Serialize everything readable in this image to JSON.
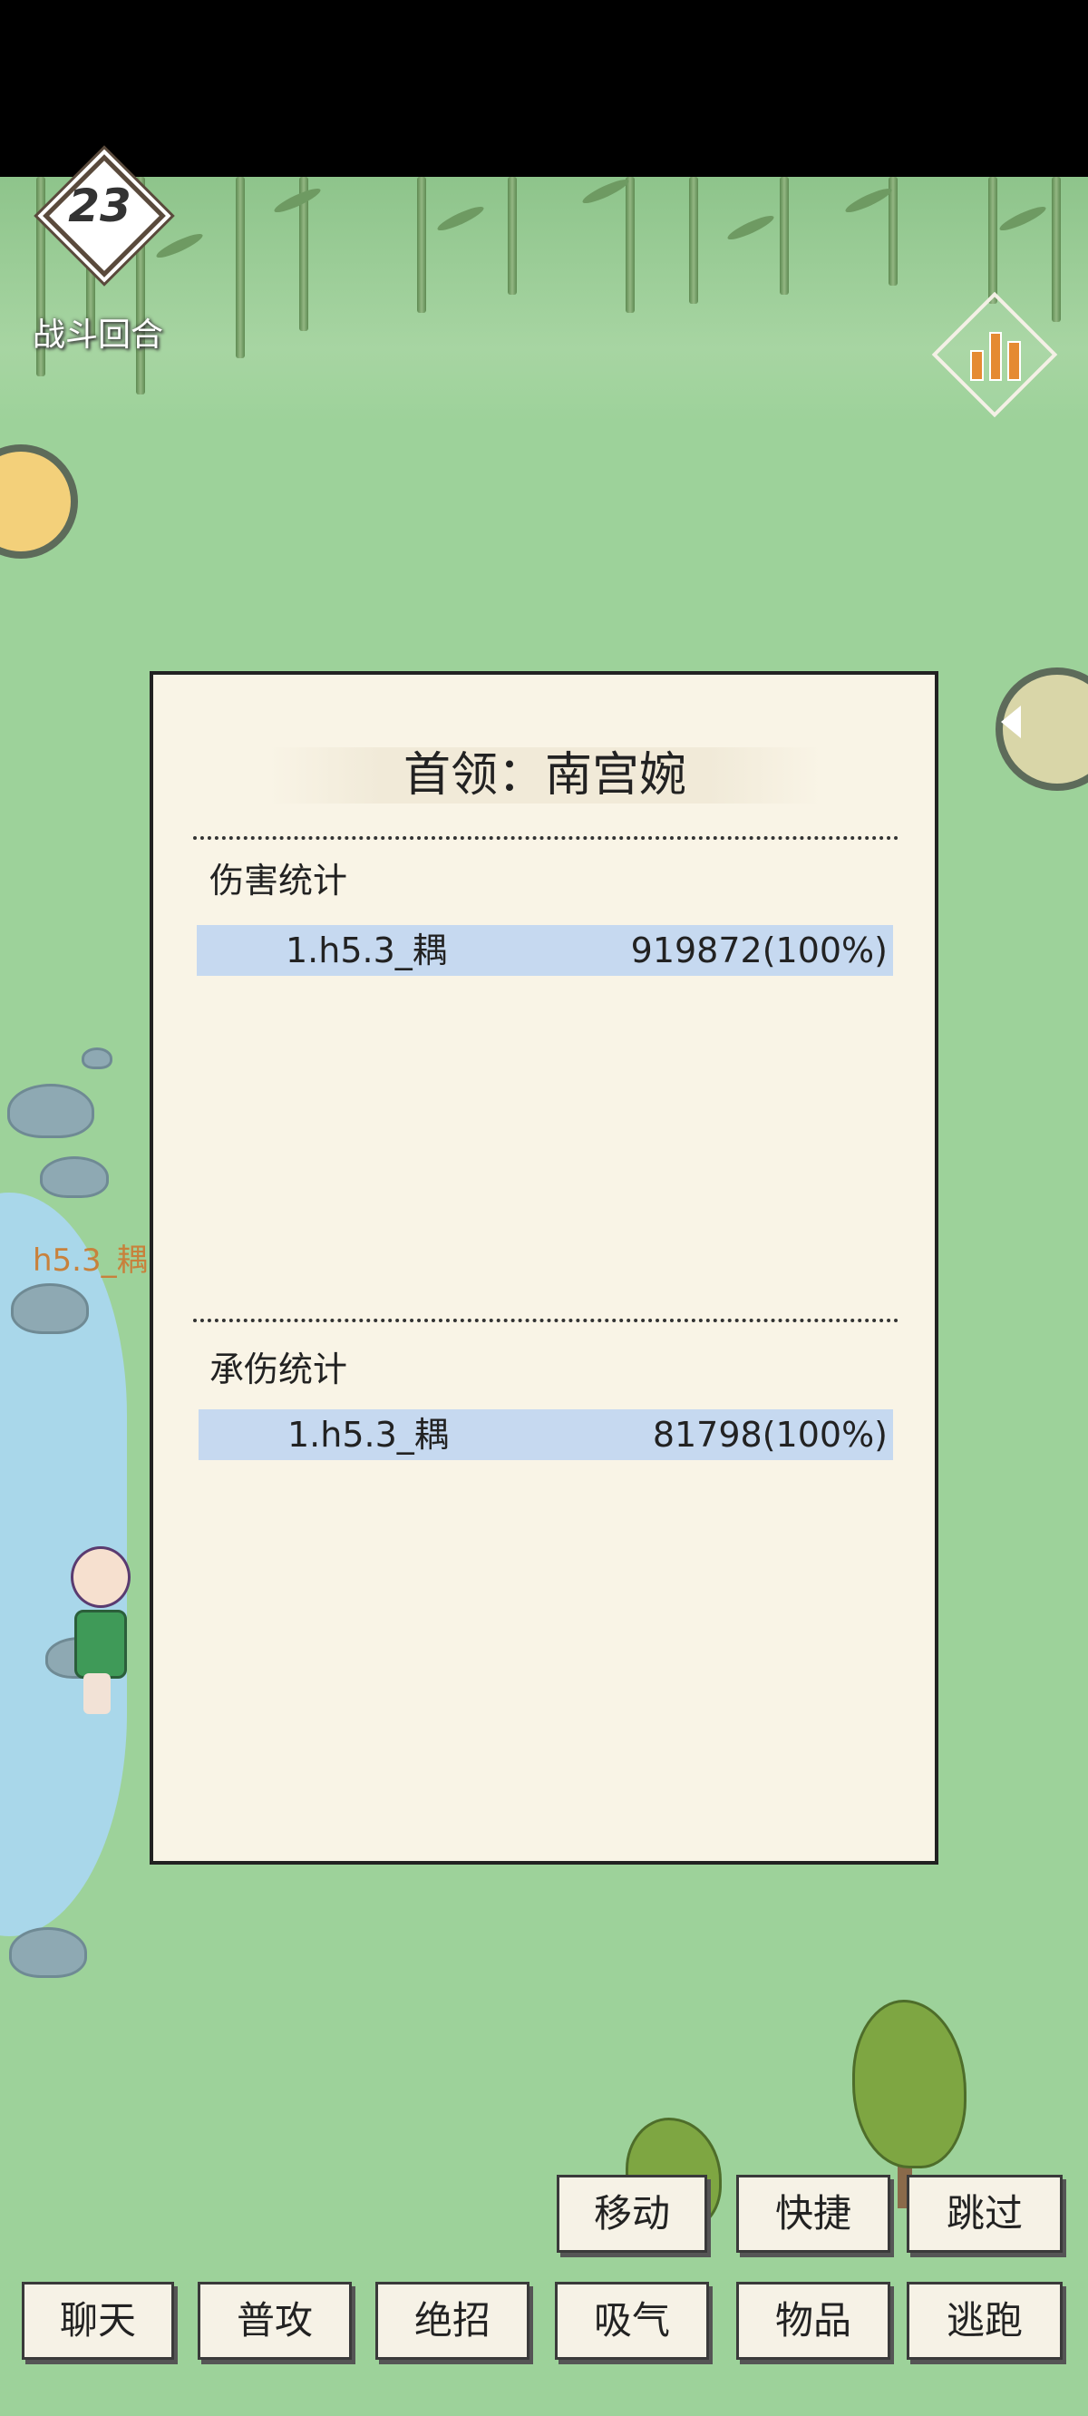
{
  "battle": {
    "round_number": "23",
    "round_label": "战斗回合"
  },
  "character": {
    "name": "h5.3_耦"
  },
  "panel": {
    "title": "首领：南宫婉",
    "damage": {
      "label": "伤害统计",
      "rows": [
        {
          "name": "1.h5.3_耦",
          "value": "919872(100%)"
        }
      ]
    },
    "taken": {
      "label": "承伤统计",
      "rows": [
        {
          "name": "1.h5.3_耦",
          "value": "81798(100%)"
        }
      ]
    }
  },
  "actions": {
    "top": {
      "move": "移动",
      "shortcut": "快捷",
      "skip": "跳过"
    },
    "bottom": {
      "chat": "聊天",
      "attack": "普攻",
      "ultimate": "绝招",
      "breathe": "吸气",
      "items": "物品",
      "flee": "逃跑"
    }
  },
  "icons": [
    "stats-chart-icon",
    "round-badge-icon",
    "left-avatar-icon",
    "right-avatar-icon",
    "arrow-left-icon"
  ]
}
